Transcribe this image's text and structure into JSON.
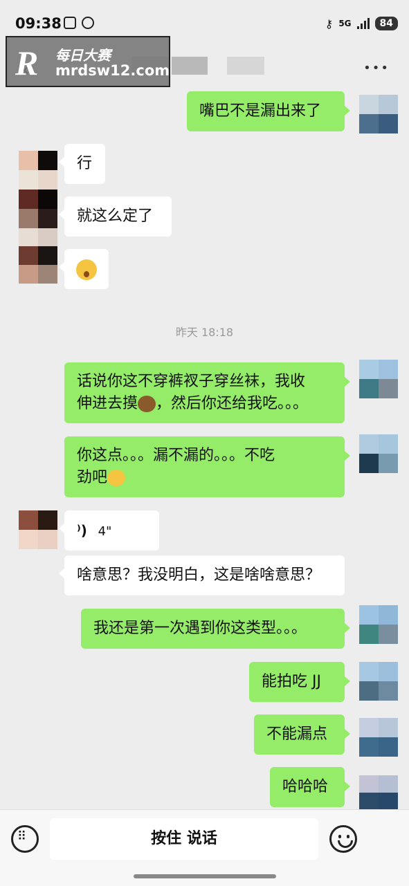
{
  "status_bar": {
    "time": "09:38",
    "network": "5G",
    "battery": "84"
  },
  "watermark": {
    "logo_text": "R",
    "site_name": "每日大赛",
    "url": "mrdsw12.com"
  },
  "messages": [
    {
      "side": "out",
      "text": "嘴巴不是漏出来了"
    },
    {
      "side": "in",
      "text": "行"
    },
    {
      "side": "in",
      "text": "就这么定了"
    },
    {
      "side": "in",
      "type": "emoji",
      "emoji": "kissing-face"
    },
    {
      "side": "out",
      "text_line1": "话说你这不穿裤衩子穿丝袜，我收",
      "text_line2_prefix": "伸进去摸",
      "text_line2_emoji": "bear-face",
      "text_line2_suffix": "，然后你还给我吃。。。"
    },
    {
      "side": "out",
      "text_line1": "你这点。。。漏不漏的。。。不吃",
      "text_line2_prefix": "劲吧",
      "text_line2_emoji": "laughing-tears-face"
    },
    {
      "side": "in",
      "type": "voice",
      "duration": "4\""
    },
    {
      "side": "in",
      "text": "啥意思？我没明白，这是啥啥意思？"
    },
    {
      "side": "out",
      "text": "我还是第一次遇到你这类型。。。"
    },
    {
      "side": "out",
      "text": "能拍吃 JJ"
    },
    {
      "side": "out",
      "text": "不能漏点"
    },
    {
      "side": "out",
      "text": "哈哈哈"
    }
  ],
  "timestamp": "昨天 18:18",
  "bottom_bar": {
    "hold_to_talk": "按住 说话"
  },
  "colors": {
    "outgoing_bubble": "#95ec69",
    "incoming_bubble": "#ffffff",
    "background": "#ededed"
  }
}
